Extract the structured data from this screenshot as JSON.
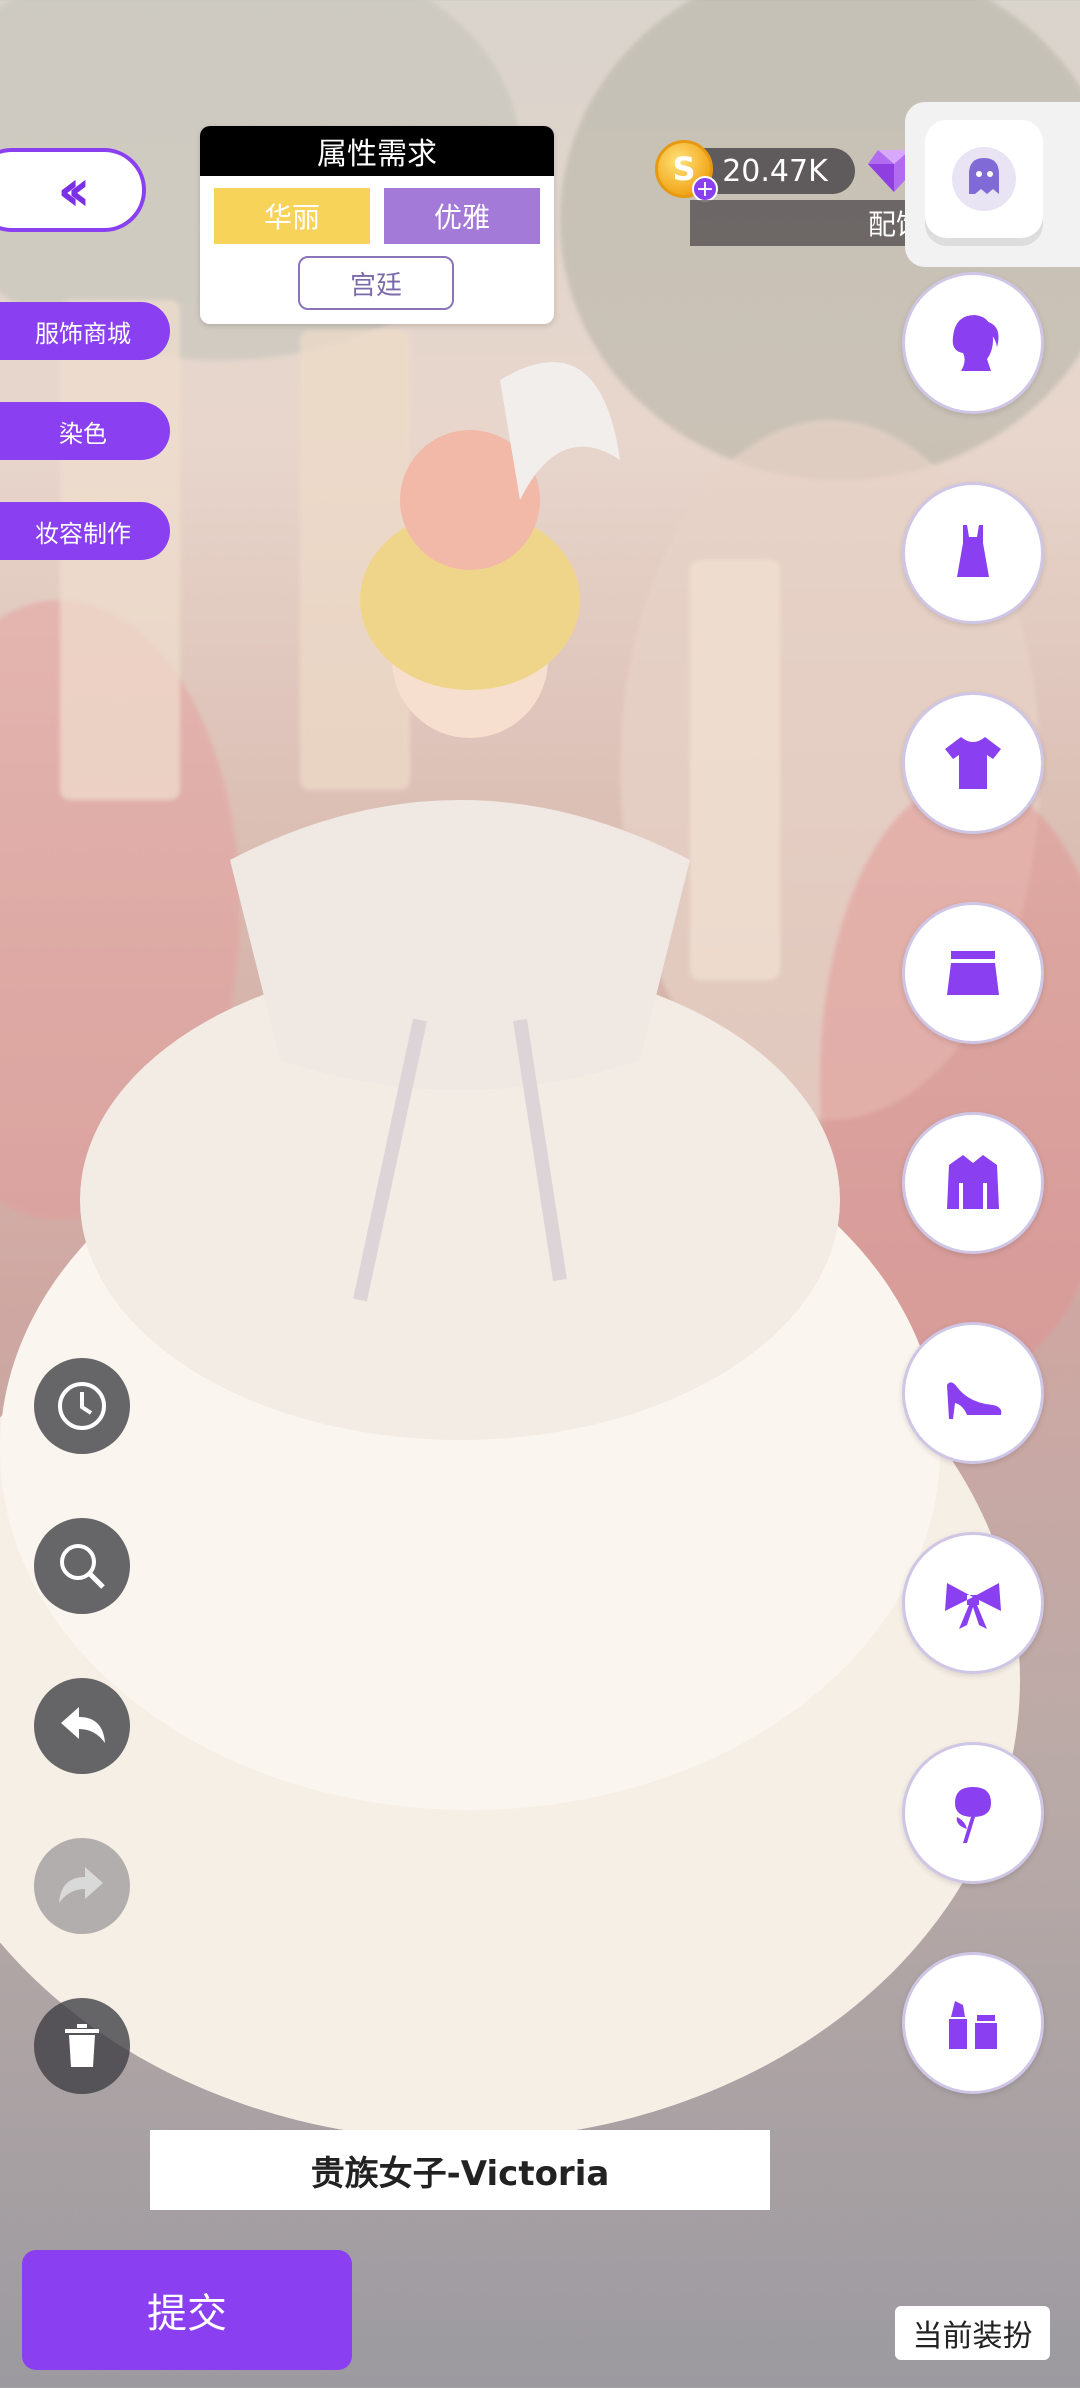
{
  "attr_card": {
    "title": "属性需求",
    "tags": [
      "华丽",
      "优雅"
    ],
    "extra_tag": "宫廷"
  },
  "side_menu": [
    "服饰商城",
    "染色",
    "妆容制作"
  ],
  "currency": {
    "coins": "20.47K"
  },
  "peihe_label": "配饰",
  "categories": [
    "hair-icon",
    "dress-icon",
    "top-icon",
    "skirt-icon",
    "coat-icon",
    "shoe-icon",
    "bow-icon",
    "rose-icon",
    "makeup-icon"
  ],
  "tools": [
    "history-icon",
    "zoom-icon",
    "undo-icon",
    "redo-icon",
    "trash-icon"
  ],
  "outfit_name": "贵族女子-Victoria",
  "submit_label": "提交",
  "current_label": "当前装扮",
  "colors": {
    "accent": "#8a3ff0",
    "tag_yellow": "#f8d35a",
    "tag_purple": "#a37ad8"
  }
}
